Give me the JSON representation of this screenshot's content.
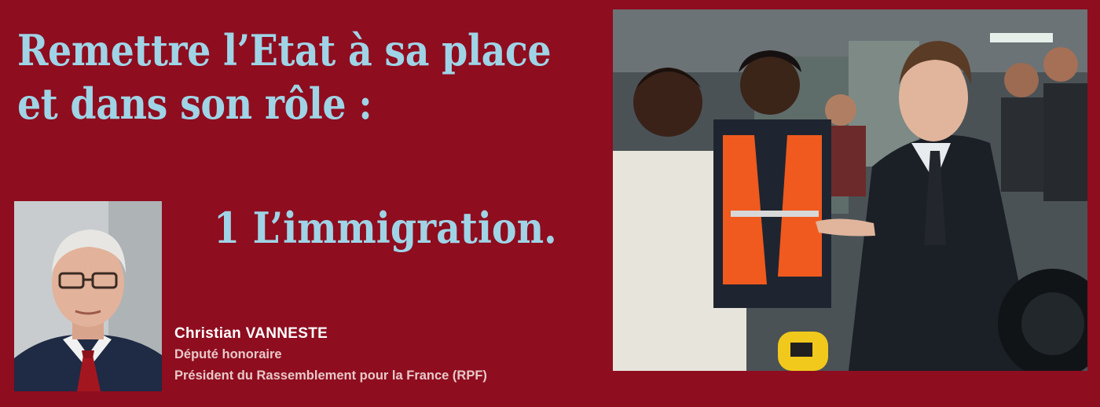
{
  "headline": {
    "line1": "Remettre l’Etat à sa place",
    "line2": "et dans son rôle :"
  },
  "subheadline": "1 L’immigration.",
  "author": {
    "name": "Christian VANNESTE",
    "title": "Député honoraire",
    "role": "Président du Rassemblement pour la France (RPF)"
  },
  "colors": {
    "background": "#8e0d1f",
    "headline_text": "#9fd4e6",
    "author_name": "#ffffff",
    "author_text": "#e8c9c9"
  }
}
